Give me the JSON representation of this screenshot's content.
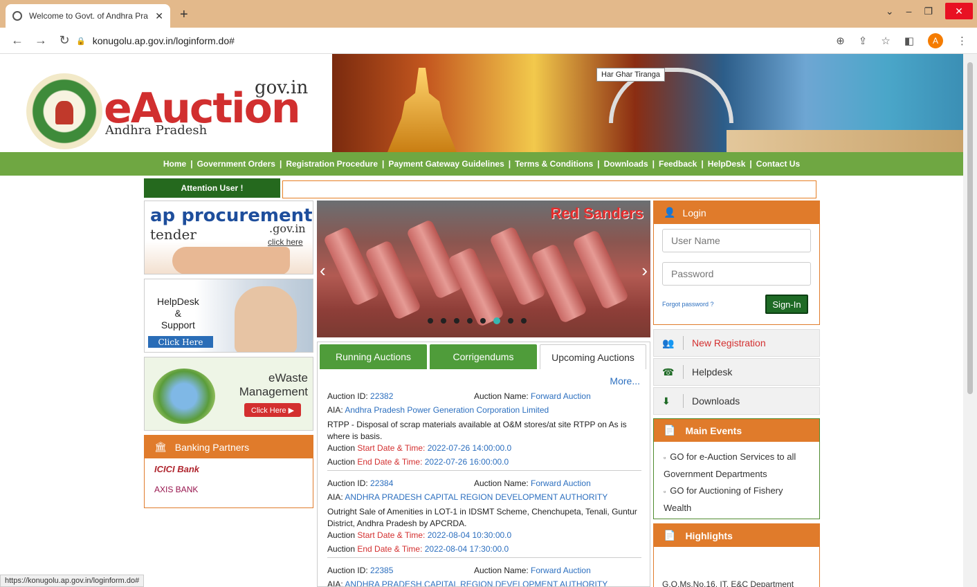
{
  "browser": {
    "tab_title": "Welcome to Govt. of Andhra Pra",
    "url": "konugolu.ap.gov.in/loginform.do#",
    "avatar_letter": "A",
    "status_url": "https://konugolu.ap.gov.in/loginform.do#"
  },
  "header": {
    "gov": "gov.in",
    "brand": "eAuction",
    "state": "Andhra Pradesh",
    "tooltip": "Har Ghar Tiranga"
  },
  "nav": [
    "Home",
    "Government Orders",
    "Registration Procedure",
    "Payment Gateway Guidelines",
    "Terms & Conditions",
    "Downloads",
    "Feedback",
    "HelpDesk",
    "Contact Us"
  ],
  "attention": "Attention User !",
  "left": {
    "ap_title": "ap procurement",
    "ap_gov": ".gov.in",
    "ap_tender": "tender",
    "ap_click": "click here",
    "help_title1": "HelpDesk",
    "help_title2": "&",
    "help_title3": "Support",
    "help_btn": "Click Here",
    "ewaste_title1": "eWaste",
    "ewaste_title2": "Management",
    "ewaste_btn": "Click Here ▶",
    "banking_title": "Banking Partners",
    "bank1": "ICICI Bank",
    "bank2": "AXIS BANK"
  },
  "slider": {
    "caption": "Red Sanders",
    "active_dot": 6
  },
  "tabs": [
    "Running Auctions",
    "Corrigendums",
    "Upcoming Auctions"
  ],
  "more": "More...",
  "labels": {
    "auction_id": "Auction ID: ",
    "auction_name": "Auction Name: ",
    "aia": "AIA: ",
    "start": "Auction ",
    "start_red": "Start Date & Time: ",
    "end": "Auction ",
    "end_red": "End Date & Time: "
  },
  "auctions": [
    {
      "id": "22382",
      "name": "Forward Auction",
      "aia": "Andhra Pradesh Power Generation Corporation Limited",
      "desc": "RTPP - Disposal of scrap materials available at O&M stores/at site RTPP on As is where is basis.",
      "start": "2022-07-26 14:00:00.0",
      "end": "2022-07-26 16:00:00.0"
    },
    {
      "id": "22384",
      "name": "Forward Auction",
      "aia": "ANDHRA PRADESH CAPITAL REGION DEVELOPMENT AUTHORITY",
      "desc": "Outright Sale of Amenities in LOT-1 in IDSMT Scheme, Chenchupeta, Tenali, Guntur District, Andhra Pradesh by APCRDA.",
      "start": "2022-08-04 10:30:00.0",
      "end": "2022-08-04 17:30:00.0"
    },
    {
      "id": "22385",
      "name": "Forward Auction",
      "aia": "ANDHRA PRADESH CAPITAL REGION DEVELOPMENT AUTHORITY",
      "desc": "",
      "start": "",
      "end": ""
    }
  ],
  "login": {
    "title": "Login",
    "user_placeholder": "User Name",
    "pass_placeholder": "Password",
    "forgot": "Forgot password ?",
    "signin": "Sign-In"
  },
  "actions": [
    "New Registration",
    "Helpdesk",
    "Downloads"
  ],
  "main_events": {
    "title": "Main Events",
    "items": [
      "GO for e-Auction Services to all Government Departments",
      "GO for Auctioning of Fishery Wealth"
    ]
  },
  "highlights": {
    "title": "Highlights",
    "text": "G.O.Ms.No.16, IT, E&C Department"
  }
}
